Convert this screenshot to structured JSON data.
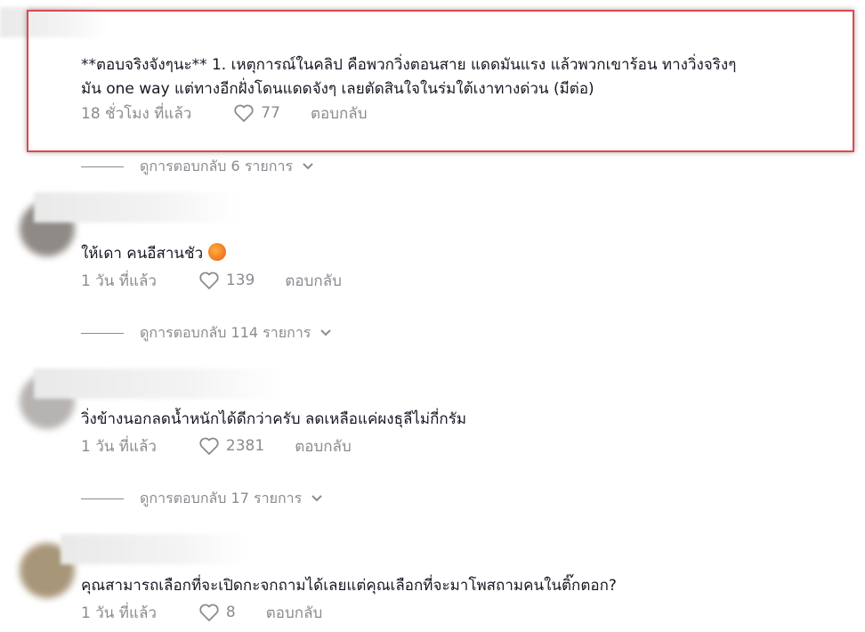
{
  "comments": [
    {
      "text_line1": "**ตอบจริงจังๆนะ** 1. เหตุการณ์ในคลิป คือพวกวิ่งตอนสาย แดดมันแรง แล้วพวกเขาร้อน ทางวิ่งจริงๆ",
      "text_line2": "มัน one way แต่ทางอีกฝั่งโดนแดดจังๆ เลยตัดสินใจในร่มใต้เงาทางด่วน (มีต่อ)",
      "time": "18 ชั่วโมง ที่แล้ว",
      "likes": "77",
      "reply": "ตอบกลับ",
      "view_replies": "ดูการตอบกลับ 6 รายการ"
    },
    {
      "text": "ให้เดา คนอีสานชัว",
      "time": "1 วัน ที่แล้ว",
      "likes": "139",
      "reply": "ตอบกลับ",
      "view_replies": "ดูการตอบกลับ 114 รายการ"
    },
    {
      "text": "วิ่งข้างนอกลดน้ำหนักได้ดีกว่าครับ ลดเหลือแค่ผงธุลีไม่กี่กรัม",
      "time": "1 วัน ที่แล้ว",
      "likes": "2381",
      "reply": "ตอบกลับ",
      "view_replies": "ดูการตอบกลับ 17 รายการ"
    },
    {
      "text": "คุณสามารถเลือกที่จะเปิดกะจกถามได้เลยแต่คุณเลือกที่จะมาโพสถามคนในติ๊กตอก?",
      "time": "1 วัน ที่แล้ว",
      "likes": "8",
      "reply": "ตอบกลับ"
    }
  ],
  "colors": {
    "highlight": "#e0474c",
    "meta_text": "#8a8b91",
    "body_text": "#161823"
  }
}
